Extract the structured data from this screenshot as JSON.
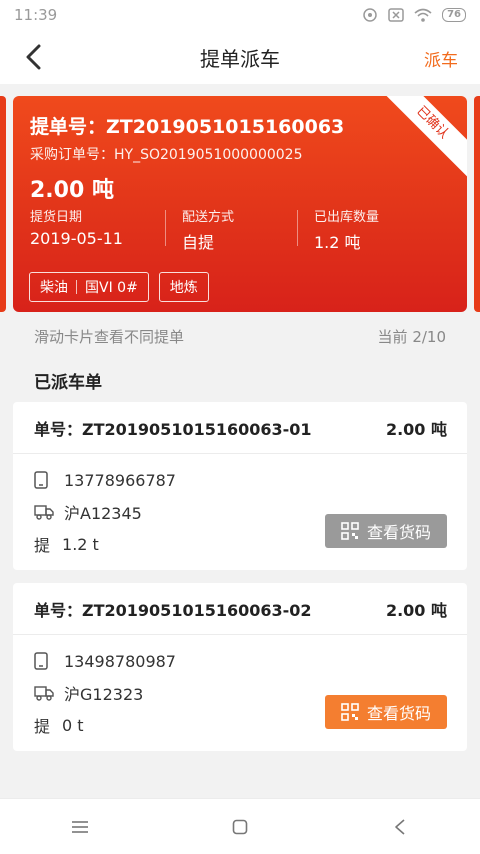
{
  "status_bar": {
    "time": "11:39",
    "battery": "76"
  },
  "nav": {
    "title": "提单派车",
    "action": "派车"
  },
  "order_card": {
    "title": "提单号：ZT2019051015160063",
    "po": "采购订单号：HY_SO2019051000000025",
    "quantity": "2.00 吨",
    "stats": [
      {
        "label": "提货日期",
        "value": "2019-05-11"
      },
      {
        "label": "配送方式",
        "value": "自提"
      },
      {
        "label": "已出库数量",
        "value": "1.2 吨"
      }
    ],
    "tags": {
      "product": "柴油",
      "grade": "国VI 0#",
      "refinery": "地炼"
    },
    "ribbon": "已确认",
    "accent_color": "#e0321a"
  },
  "hint": {
    "swipe": "滑动卡片查看不同提单",
    "pager": "当前 2/10"
  },
  "section_title": "已派车单",
  "dispatches": [
    {
      "no": "单号：ZT2019051015160063-01",
      "weight": "2.00 吨",
      "phone": "13778966787",
      "plate": "沪A12345",
      "pickup_label": "提",
      "pickup": "1.2 t",
      "button": "查看货码",
      "button_color": "#9a9a9a"
    },
    {
      "no": "单号：ZT2019051015160063-02",
      "weight": "2.00 吨",
      "phone": "13498780987",
      "plate": "沪G12323",
      "pickup_label": "提",
      "pickup": "0 t",
      "button": "查看货码",
      "button_color": "#f47e30"
    }
  ],
  "icons": {
    "back": "chevron-left-icon",
    "phone": "phone-icon",
    "truck": "truck-icon",
    "qr": "qr-code-icon",
    "menu": "menu-icon",
    "home": "square-icon",
    "nav_back": "triangle-back-icon"
  }
}
